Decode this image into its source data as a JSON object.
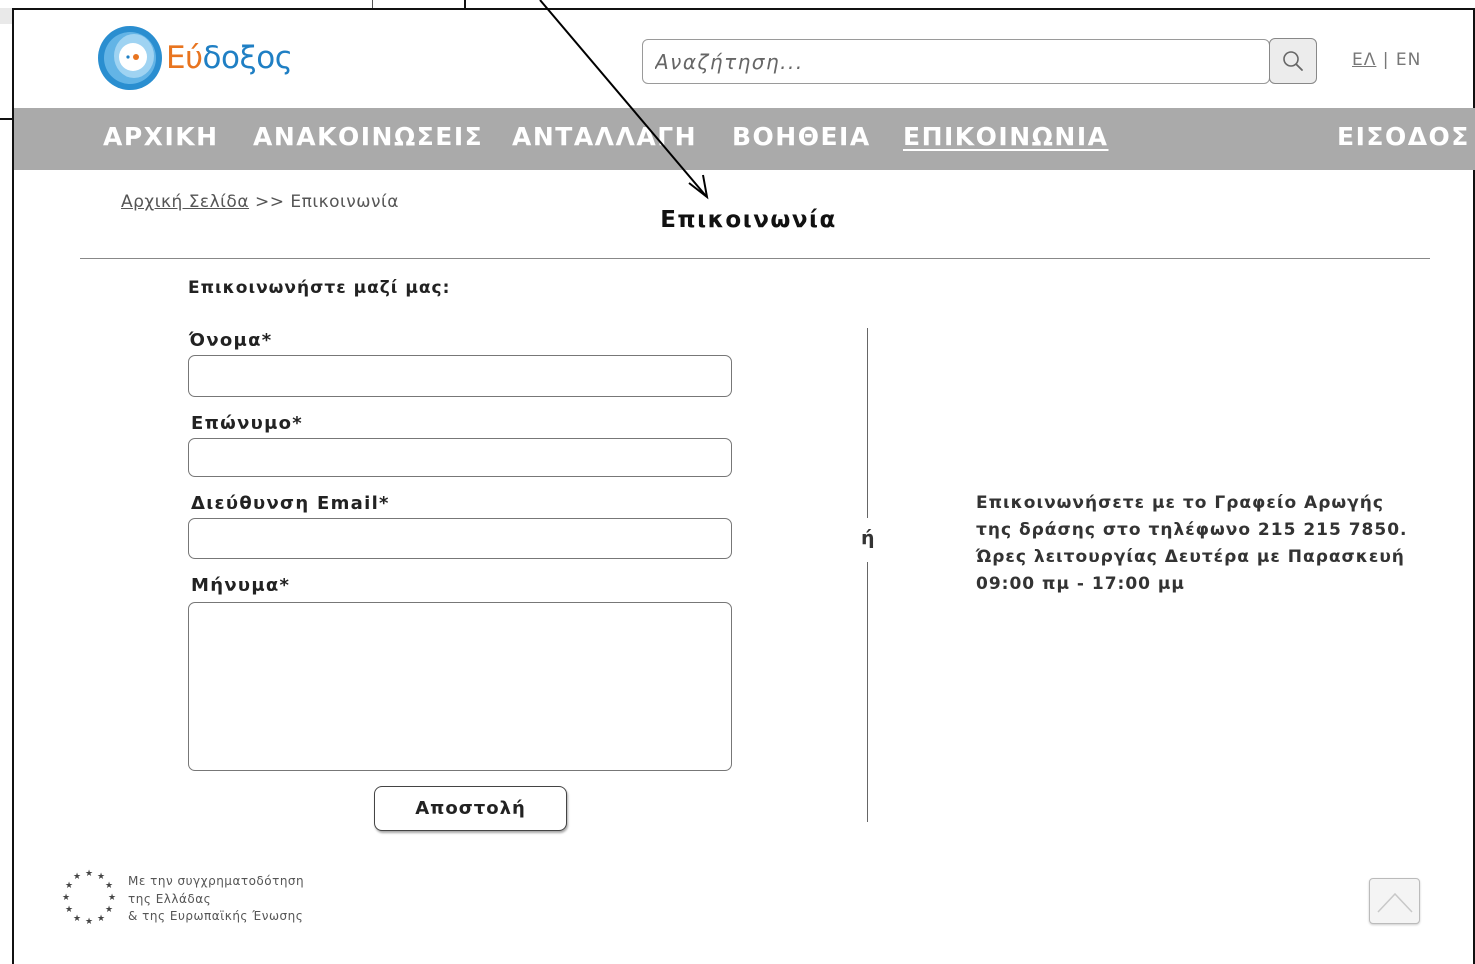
{
  "header": {
    "logo_text_part1": "Εύ",
    "logo_text_part2": "δοξος",
    "search_placeholder": "Αναζήτηση...",
    "lang_el": "ΕΛ",
    "lang_separator": "|",
    "lang_en": "EN"
  },
  "nav": {
    "items": [
      {
        "label": "ΑΡΧΙΚΗ"
      },
      {
        "label": "ΑΝΑΚΟΙΝΩΣΕΙΣ"
      },
      {
        "label": "ΑΝΤΑΛΛΑΓΗ"
      },
      {
        "label": "ΒΟΗΘΕΙΑ"
      },
      {
        "label": "ΕΠΙΚΟΙΝΩΝΙΑ",
        "active": true
      },
      {
        "label": "ΕΙΣΟΔΟΣ"
      }
    ]
  },
  "breadcrumb": {
    "home": "Αρχική Σελίδα",
    "separator": ">>",
    "current": "Επικοινωνία"
  },
  "page": {
    "title": "Επικοινωνία",
    "section_heading": "Επικοινωνήστε μαζί μας:"
  },
  "form": {
    "first_name_label": "Όνομα*",
    "first_name_value": "",
    "last_name_label": "Επώνυμο*",
    "last_name_value": "",
    "email_label": "Διεύθυνση Email*",
    "email_value": "",
    "message_label": "Μήνυμα*",
    "message_value": "",
    "submit_label": "Αποστολή"
  },
  "alternative": {
    "or_label": "ή",
    "line1": "Επικοινωνήσετε με το Γραφείο Αρωγής",
    "line2": "της δράσης στο τηλέφωνο 215 215 7850.",
    "line3": "Ώρες λειτουργίας Δευτέρα με Παρασκευή",
    "line4": "09:00 πμ - 17:00 μμ"
  },
  "footer": {
    "line1": "Με την συγχρηματοδότηση",
    "line2": "της Ελλάδας",
    "line3": "& της Ευρωπαϊκής Ένωσης"
  },
  "colors": {
    "nav_bg": "#aaaaaa",
    "logo_orange": "#e8741f",
    "logo_blue": "#1f7fc4"
  }
}
